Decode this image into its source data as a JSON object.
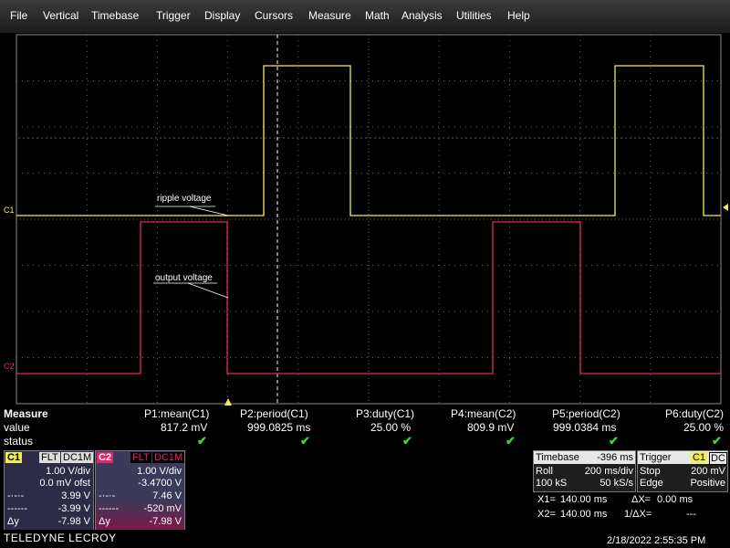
{
  "menu": [
    "File",
    "Vertical",
    "Timebase",
    "Trigger",
    "Display",
    "Cursors",
    "Measure",
    "Math",
    "Analysis",
    "Utilities",
    "Help"
  ],
  "traces": {
    "c1_marker": "C1",
    "c2_marker": "C2",
    "c1_annotation": "ripple voltage",
    "c2_annotation": "output voltage",
    "c1_color": "#f2ee50",
    "c2_color": "#e8236b"
  },
  "measure": {
    "header": "Measure",
    "row_value": "value",
    "row_status": "status",
    "columns": [
      {
        "label": "P1:mean(C1)",
        "value": "817.2 mV"
      },
      {
        "label": "P2:period(C1)",
        "value": "999.0825 ms"
      },
      {
        "label": "P3:duty(C1)",
        "value": "25.00 %"
      },
      {
        "label": "P4:mean(C2)",
        "value": "809.9 mV"
      },
      {
        "label": "P5:period(C2)",
        "value": "999.0384 ms"
      },
      {
        "label": "P6:duty(C2)",
        "value": "25.00 %"
      }
    ],
    "check": "✔"
  },
  "ch1": {
    "name": "C1",
    "coupling": "FLT",
    "impedance": "DC1M",
    "vdiv": "1.00 V/div",
    "offset": "0.0 mV ofst",
    "cursor1_label": "-·-·-",
    "cursor1": "3.99 V",
    "cursor2_label": "------",
    "cursor2": "-3.99 V",
    "delta_label": "Δy",
    "delta": "-7.98 V"
  },
  "ch2": {
    "name": "C2",
    "coupling": "FLT",
    "impedance": "DC1M",
    "vdiv": "1.00 V/div",
    "offset": "-3.4700 V",
    "cursor1_label": "-·-·-",
    "cursor1": "7.46 V",
    "cursor2_label": "------",
    "cursor2": "-520 mV",
    "delta_label": "Δy",
    "delta": "-7.98 V"
  },
  "timebase": {
    "label": "Timebase",
    "delay": "-396 ms",
    "mode": "Roll",
    "tdiv": "200 ms/div",
    "samples": "100 kS",
    "rate": "50 kS/s"
  },
  "trigger": {
    "label": "Trigger",
    "source": "C1",
    "coupling": "DC",
    "mode": "Stop",
    "level": "200 mV",
    "type": "Edge",
    "slope": "Positive"
  },
  "cursors": {
    "x1_label": "X1=",
    "x1": "140.00 ms",
    "dx_label": "ΔX=",
    "dx": "0.00 ms",
    "x2_label": "X2=",
    "x2": "140.00 ms",
    "inv_label": "1/ΔX=",
    "inv": "---"
  },
  "brand": "TELEDYNE LECROY",
  "datetime": "2/18/2022 2:55:35 PM"
}
